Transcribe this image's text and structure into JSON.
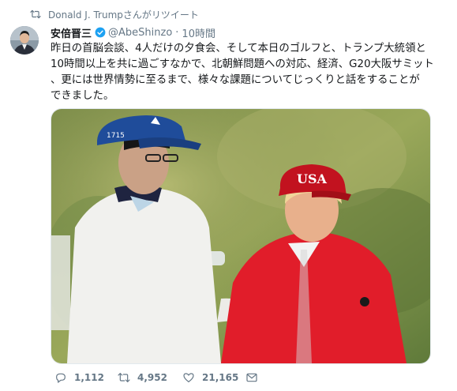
{
  "retweet": {
    "text": "Donald J. Trumpさんがリツイート"
  },
  "author": {
    "name": "安倍晋三",
    "handle": "@AbeShinzo",
    "separator": "·",
    "time": "10時間"
  },
  "tweet": {
    "lines": [
      "昨日の首脳会談、4人だけの夕食会、そして本日のゴルフと、トランプ大統領と",
      "10時間以上を共に過ごすなかで、北朝鮮問題への対応、経済、G20大阪サミット",
      "、更には世界情勢に至るまで、様々な課題についてじっくりと話をすることが",
      "できました。"
    ]
  },
  "media": {
    "cap_text": "USA"
  },
  "actions": {
    "replies": "1,112",
    "retweets": "4,952",
    "likes": "21,165"
  },
  "colors": {
    "accent": "#1da1f2",
    "muted": "#657786",
    "text": "#14171a"
  }
}
